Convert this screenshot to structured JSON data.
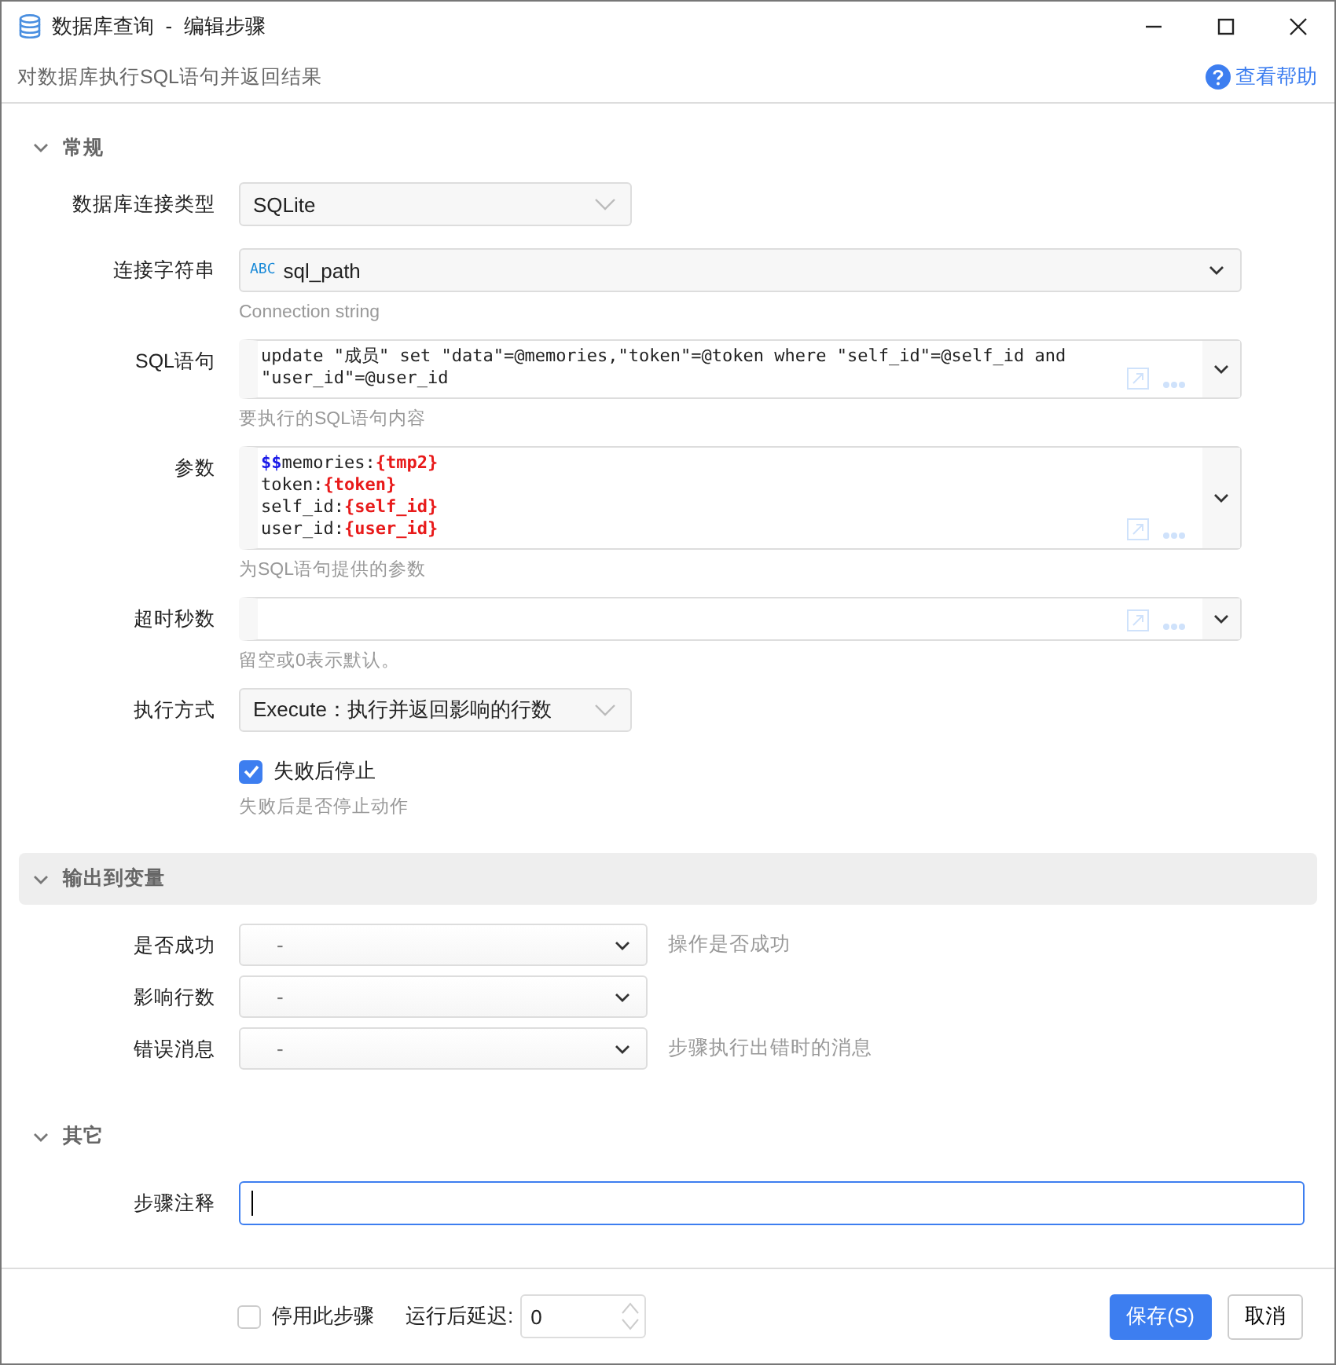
{
  "window": {
    "title": "数据库查询  -  编辑步骤",
    "subtitle": "对数据库执行SQL语句并返回结果",
    "help_link": "查看帮助"
  },
  "sections": [
    {
      "title": "常规",
      "expanded": true,
      "highlighted": false,
      "fields": [
        {
          "kind": "select",
          "label": "数据库连接类型",
          "value": "SQLite"
        },
        {
          "kind": "text-select",
          "label": "连接字符串",
          "badge": "ABC",
          "value": "sql_path",
          "hint": "Connection string"
        },
        {
          "kind": "code",
          "label": "SQL语句",
          "hint": "要执行的SQL语句内容",
          "lines": [
            [
              {
                "kind": "plain",
                "text": "update \"成员\" set \"data\"=@memories,\"token\"=@token where \"self_id\"=@self_id and"
              }
            ],
            [
              {
                "kind": "plain",
                "text": "\"user_id\"=@user_id"
              }
            ]
          ]
        },
        {
          "kind": "code",
          "label": "参数",
          "hint": "为SQL语句提供的参数",
          "lines": [
            [
              {
                "kind": "prefix",
                "text": "$$"
              },
              {
                "kind": "plain",
                "text": "memories:"
              },
              {
                "kind": "var",
                "text": "{tmp2}"
              }
            ],
            [
              {
                "kind": "plain",
                "text": "token:"
              },
              {
                "kind": "var",
                "text": "{token}"
              }
            ],
            [
              {
                "kind": "plain",
                "text": "self_id:"
              },
              {
                "kind": "var",
                "text": "{self_id}"
              }
            ],
            [
              {
                "kind": "plain",
                "text": "user_id:"
              },
              {
                "kind": "var",
                "text": "{user_id}"
              }
            ]
          ]
        },
        {
          "kind": "code",
          "label": "超时秒数",
          "hint": "留空或0表示默认。"
        },
        {
          "kind": "select",
          "label": "执行方式",
          "value": "Execute：执行并返回影响的行数"
        },
        {
          "kind": "checkbox",
          "label": "失败后停止",
          "checked": true,
          "hint": "失败后是否停止动作"
        }
      ]
    },
    {
      "title": "输出到变量",
      "expanded": true,
      "highlighted": true,
      "fields": [
        {
          "kind": "output",
          "label": "是否成功",
          "value": "-",
          "note": "操作是否成功"
        },
        {
          "kind": "output",
          "label": "影响行数",
          "value": "-"
        },
        {
          "kind": "output",
          "label": "错误消息",
          "value": "-",
          "note": "步骤执行出错时的消息"
        }
      ]
    },
    {
      "title": "其它",
      "expanded": true,
      "highlighted": false,
      "fields": [
        {
          "kind": "input",
          "label": "步骤注释",
          "focused": true
        }
      ]
    }
  ],
  "footer": {
    "disable": {
      "label": "停用此步骤",
      "checked": false
    },
    "delay": {
      "label": "运行后延迟:",
      "value": "0"
    },
    "buttons": [
      {
        "label": "保存(S)",
        "primary": true
      },
      {
        "label": "取消",
        "primary": false
      }
    ]
  }
}
